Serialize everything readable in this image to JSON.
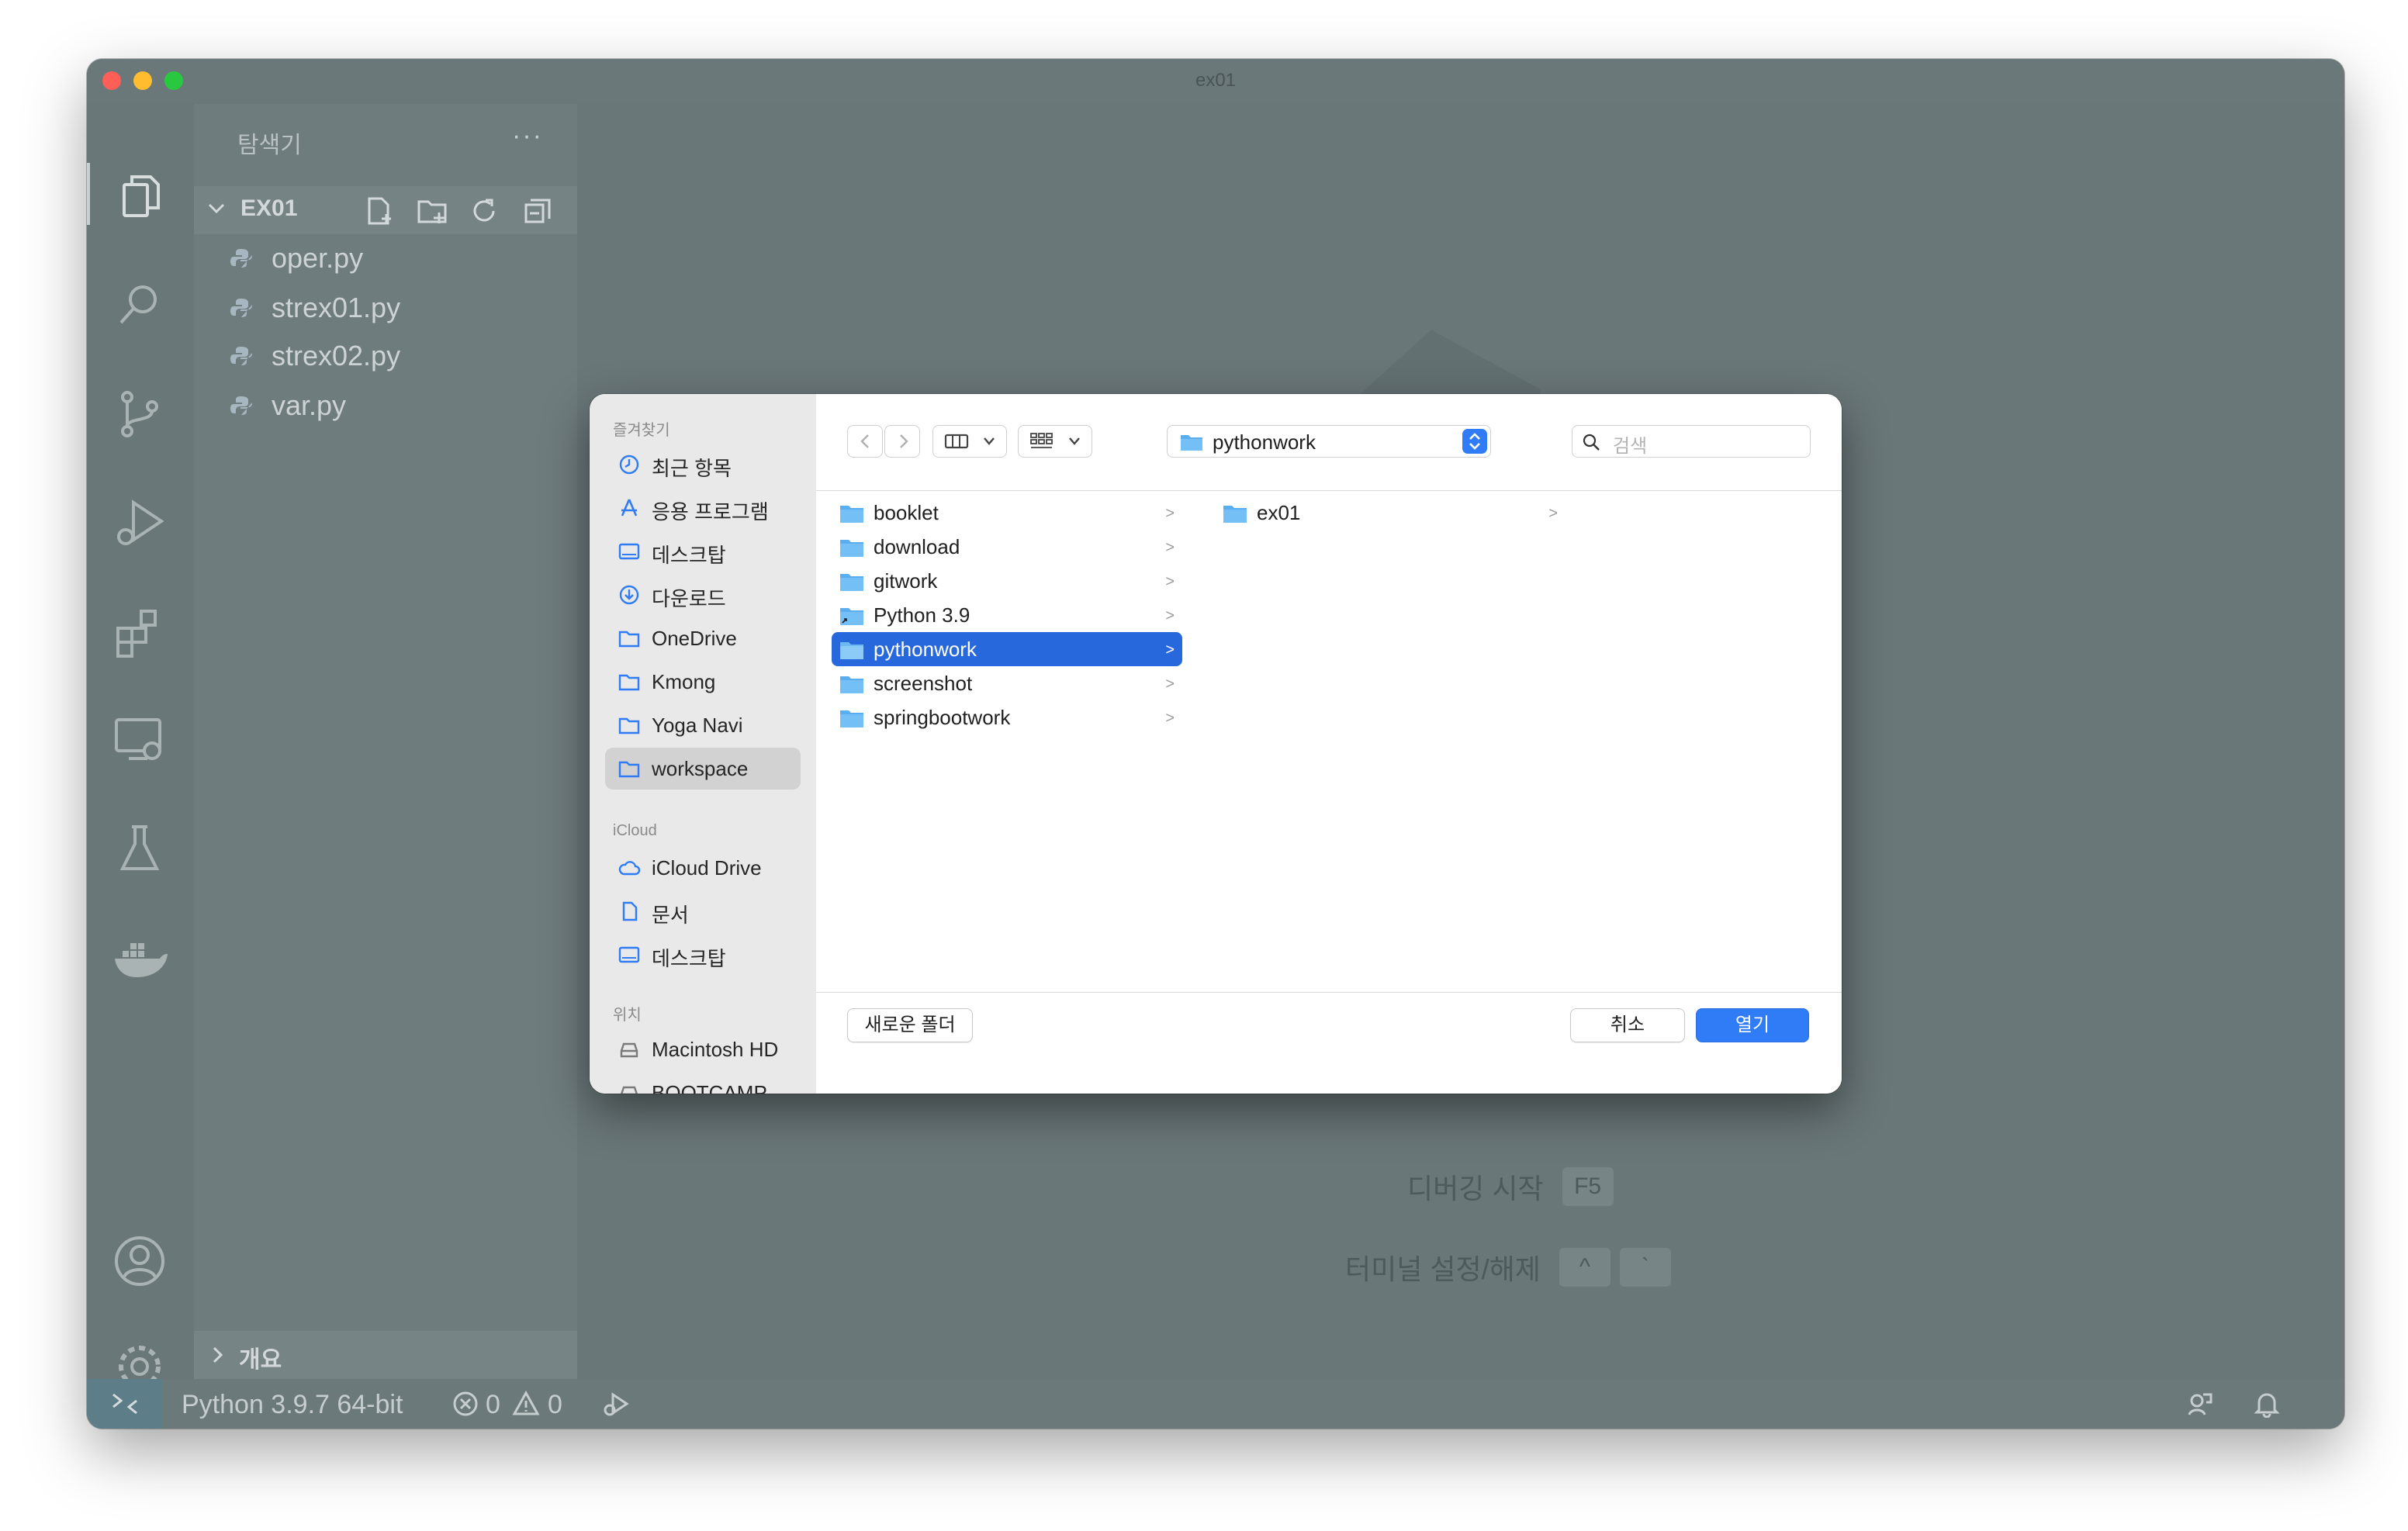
{
  "window": {
    "title": "ex01"
  },
  "activity_bar": {
    "items": [
      "explorer-icon",
      "search-icon",
      "source-control-icon",
      "run-debug-icon",
      "extensions-icon",
      "remote-explorer-icon",
      "testing-icon",
      "docker-icon"
    ],
    "bottom_items": [
      "account-icon",
      "settings-gear-icon"
    ]
  },
  "sidebar": {
    "title": "탐색기",
    "more": "···",
    "section": "EX01",
    "files": [
      {
        "name": "oper.py"
      },
      {
        "name": "strex01.py"
      },
      {
        "name": "strex02.py"
      },
      {
        "name": "var.py"
      }
    ],
    "outline": "개요"
  },
  "editor_hints": {
    "debug": {
      "label": "디버깅 시작",
      "keys": [
        "F5"
      ]
    },
    "terminal": {
      "label": "터미널 설정/해제",
      "keys": [
        "^",
        "`"
      ]
    }
  },
  "statusbar": {
    "python": "Python 3.9.7 64-bit",
    "errors": "0",
    "warnings": "0"
  },
  "dialog": {
    "sidebar": {
      "favorites_header": "즐겨찾기",
      "favorites": [
        "최근 항목",
        "응용 프로그램",
        "데스크탑",
        "다운로드",
        "OneDrive",
        "Kmong",
        "Yoga Navi",
        "workspace"
      ],
      "selected_favorite": "workspace",
      "icloud_header": "iCloud",
      "icloud": [
        "iCloud Drive",
        "문서",
        "데스크탑"
      ],
      "locations_header": "위치",
      "locations": [
        "Macintosh HD",
        "BOOTCAMP"
      ]
    },
    "toolbar": {
      "path": "pythonwork",
      "search_placeholder": "검색"
    },
    "column1": [
      "booklet",
      "download",
      "gitwork",
      "Python 3.9",
      "pythonwork",
      "screenshot",
      "springbootwork"
    ],
    "column1_selected": "pythonwork",
    "column2": [
      "ex01"
    ],
    "footer": {
      "new_folder": "새로운 폴더",
      "cancel": "취소",
      "open": "열기"
    },
    "accent": "#2f7cf6"
  }
}
